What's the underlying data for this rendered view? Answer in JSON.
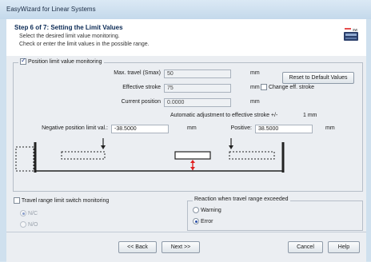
{
  "window": {
    "title": "EasyWizard for Linear Systems"
  },
  "header": {
    "step_title": "Step 6 of 7: Setting the Limit Values",
    "subtitle_line1": "Select the desired limit value monitoring.",
    "subtitle_line2": "Check or enter the limit values in the possible range."
  },
  "position_group": {
    "checkbox_label": "Position limit value monitoring",
    "checked": true,
    "max_travel": {
      "label": "Max. travel (Smax)",
      "value": "50",
      "unit": "mm"
    },
    "effective_stroke": {
      "label": "Effective stroke",
      "value": "75",
      "unit": "mm"
    },
    "current_position": {
      "label": "Current position",
      "value": "0.0000",
      "unit": "mm"
    },
    "change_stroke_label": "Change eff. stroke",
    "reset_button": "Reset to Default Values",
    "auto_adjust_text": "Automatic adjustment to effective stroke +/-",
    "auto_adjust_value": "1 mm",
    "negative_limit": {
      "label": "Negative position limit val.:",
      "value": "-38.5000",
      "unit": "mm"
    },
    "positive_limit": {
      "label": "Positive:",
      "value": "38.5000",
      "unit": "mm"
    }
  },
  "travel_group": {
    "checkbox_label": "Travel range limit switch monitoring",
    "checked": false,
    "options": [
      "N/C",
      "N/O"
    ],
    "selected": "N/C"
  },
  "reaction_group": {
    "title": "Reaction when travel range exceeded",
    "options": [
      "Warning",
      "Error"
    ],
    "selected": "Error"
  },
  "footer": {
    "back": "<< Back",
    "next": "Next >>",
    "cancel": "Cancel",
    "help": "Help"
  },
  "colors": {
    "title_text": "#0b2a55",
    "marker_red": "#e02020",
    "field_border": "#a9b2bd"
  }
}
